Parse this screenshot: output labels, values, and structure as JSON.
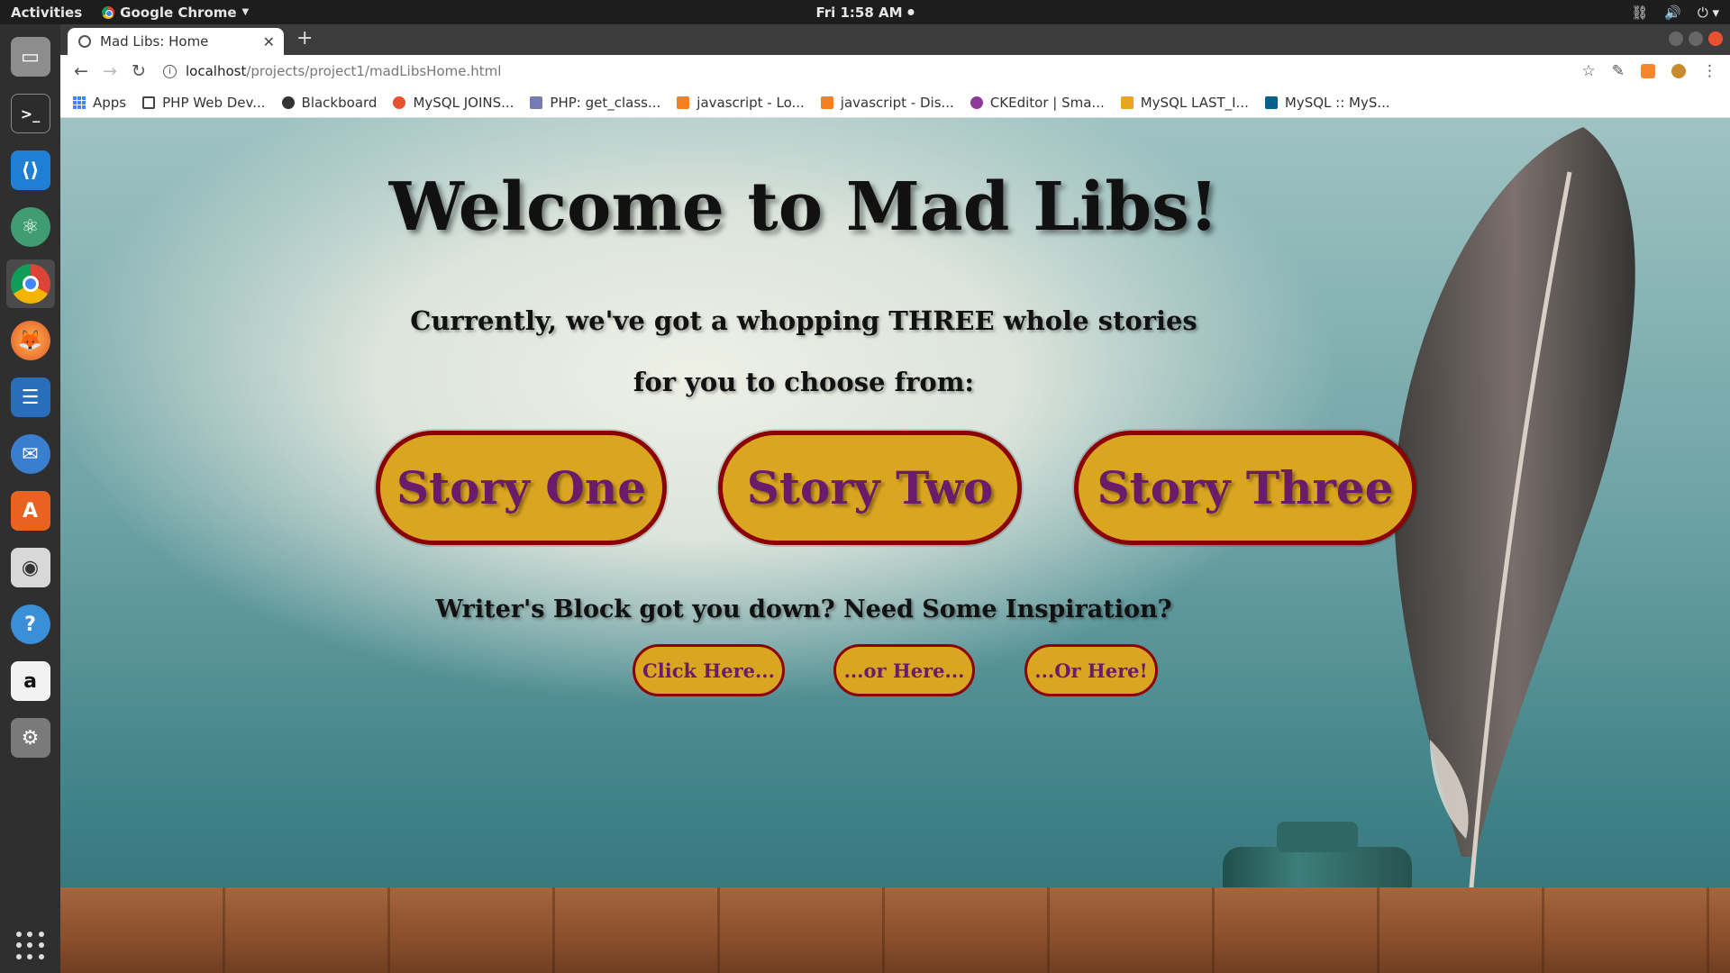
{
  "system": {
    "activities": "Activities",
    "app_name": "Google Chrome",
    "clock": "Fri  1:58 AM"
  },
  "dock": {
    "items": [
      "files-icon",
      "terminal-icon",
      "vscode-icon",
      "atom-icon",
      "chrome-icon",
      "firefox-icon",
      "writer-icon",
      "thunderbird-icon",
      "software-center-icon",
      "rhythmbox-icon",
      "help-icon",
      "amazon-icon",
      "settings-icon"
    ]
  },
  "browser": {
    "tab_title": "Mad Libs: Home",
    "url_host": "localhost",
    "url_path": "/projects/project1/madLibsHome.html",
    "bookmarks": [
      {
        "label": "Apps",
        "color": "#4285f4"
      },
      {
        "label": "PHP Web Dev...",
        "color": "#444444"
      },
      {
        "label": "Blackboard",
        "color": "#333333"
      },
      {
        "label": "MySQL JOINS...",
        "color": "#e8512f"
      },
      {
        "label": "PHP: get_class...",
        "color": "#777bb3"
      },
      {
        "label": "javascript - Lo...",
        "color": "#f48024"
      },
      {
        "label": "javascript - Dis...",
        "color": "#f48024"
      },
      {
        "label": "CKEditor | Sma...",
        "color": "#8e3a9a"
      },
      {
        "label": "MySQL LAST_I...",
        "color": "#e8a520"
      },
      {
        "label": "MySQL :: MyS...",
        "color": "#00618a"
      }
    ]
  },
  "page": {
    "title": "Welcome to Mad Libs!",
    "subtitle_line1": "Currently, we've got a whopping THREE whole stories",
    "subtitle_line2": "for you to choose from:",
    "stories": [
      "Story One",
      "Story Two",
      "Story Three"
    ],
    "inspiration_prompt": "Writer's Block got you down? Need Some Inspiration?",
    "inspiration_links": [
      "Click Here...",
      "...or Here...",
      "...Or Here!"
    ]
  },
  "colors": {
    "button_fill": "#daa520",
    "button_border": "#8b0000",
    "button_text": "#6a1b6a"
  }
}
